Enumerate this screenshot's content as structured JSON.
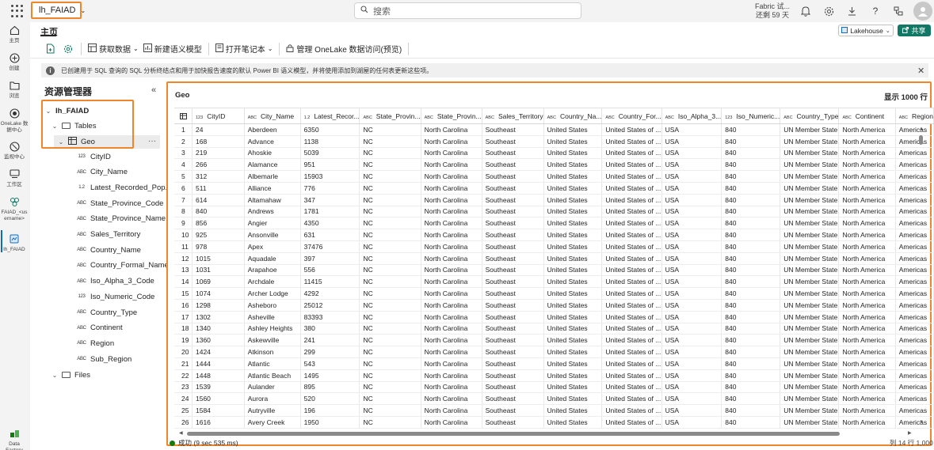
{
  "app": {
    "workspace_name": "lh_FAIAD",
    "search_placeholder": "搜索",
    "trial_line1": "Fabric 试...",
    "trial_line2": "还剩 59 天"
  },
  "rail": [
    {
      "label": "主页",
      "icon": "home-icon"
    },
    {
      "label": "创建",
      "icon": "create-icon"
    },
    {
      "label": "浏览",
      "icon": "browse-icon"
    },
    {
      "label": "OneLake 数据中心",
      "icon": "onelake-icon"
    },
    {
      "label": "监视中心",
      "icon": "monitor-icon"
    },
    {
      "label": "工作区",
      "icon": "workspaces-icon"
    },
    {
      "label": "FAIAD_<username>",
      "icon": "workspace-icon"
    },
    {
      "label": "lh_FAIAD",
      "icon": "lakehouse-icon"
    },
    {
      "label": "Data Factory",
      "icon": "data-factory-icon"
    }
  ],
  "ribbon": {
    "tab_home": "主页",
    "get_data": "获取数据",
    "new_semantic_model": "新建语义模型",
    "open_notebook": "打开笔记本",
    "manage_onelake": "管理 OneLake 数据访问(预览)",
    "lakehouse_switch": "Lakehouse",
    "share": "共享"
  },
  "info_message": "已创建用于 SQL 查询的 SQL 分析终结点和用于加快报告速度的默认 Power BI 语义模型，并将使用添加到湖屋的任何表更新这些项。",
  "explorer": {
    "title": "资源管理器",
    "lakehouse": "lh_FAIAD",
    "tables_label": "Tables",
    "table_name": "Geo",
    "files_label": "Files",
    "columns": [
      {
        "type": "123",
        "name": "CityID"
      },
      {
        "type": "ABC",
        "name": "City_Name"
      },
      {
        "type": "1.2",
        "name": "Latest_Recorded_Pop..."
      },
      {
        "type": "ABC",
        "name": "State_Province_Code"
      },
      {
        "type": "ABC",
        "name": "State_Province_Name"
      },
      {
        "type": "ABC",
        "name": "Sales_Territory"
      },
      {
        "type": "ABC",
        "name": "Country_Name"
      },
      {
        "type": "ABC",
        "name": "Country_Formal_Name"
      },
      {
        "type": "ABC",
        "name": "Iso_Alpha_3_Code"
      },
      {
        "type": "123",
        "name": "Iso_Numeric_Code"
      },
      {
        "type": "ABC",
        "name": "Country_Type"
      },
      {
        "type": "ABC",
        "name": "Continent"
      },
      {
        "type": "ABC",
        "name": "Region"
      },
      {
        "type": "ABC",
        "name": "Sub_Region"
      }
    ]
  },
  "grid": {
    "title": "Geo",
    "row_count_label": "显示 1000 行",
    "columns": [
      {
        "type": "123",
        "name": "CityID"
      },
      {
        "type": "ABC",
        "name": "City_Name"
      },
      {
        "type": "1.2",
        "name": "Latest_Recor..."
      },
      {
        "type": "ABC",
        "name": "State_Provin..."
      },
      {
        "type": "ABC",
        "name": "State_Provin..."
      },
      {
        "type": "ABC",
        "name": "Sales_Territory"
      },
      {
        "type": "ABC",
        "name": "Country_Na..."
      },
      {
        "type": "ABC",
        "name": "Country_For..."
      },
      {
        "type": "ABC",
        "name": "Iso_Alpha_3..."
      },
      {
        "type": "123",
        "name": "Iso_Numeric..."
      },
      {
        "type": "ABC",
        "name": "Country_Type"
      },
      {
        "type": "ABC",
        "name": "Continent"
      },
      {
        "type": "ABC",
        "name": "Region"
      }
    ],
    "rows": [
      [
        "1",
        "24",
        "Aberdeen",
        "6350",
        "NC",
        "North Carolina",
        "Southeast",
        "United States",
        "United States of ...",
        "USA",
        "840",
        "UN Member State",
        "North America",
        "Americas"
      ],
      [
        "2",
        "168",
        "Advance",
        "1138",
        "NC",
        "North Carolina",
        "Southeast",
        "United States",
        "United States of ...",
        "USA",
        "840",
        "UN Member State",
        "North America",
        "Americas"
      ],
      [
        "3",
        "219",
        "Ahoskie",
        "5039",
        "NC",
        "North Carolina",
        "Southeast",
        "United States",
        "United States of ...",
        "USA",
        "840",
        "UN Member State",
        "North America",
        "Americas"
      ],
      [
        "4",
        "266",
        "Alamance",
        "951",
        "NC",
        "North Carolina",
        "Southeast",
        "United States",
        "United States of ...",
        "USA",
        "840",
        "UN Member State",
        "North America",
        "Americas"
      ],
      [
        "5",
        "312",
        "Albemarle",
        "15903",
        "NC",
        "North Carolina",
        "Southeast",
        "United States",
        "United States of ...",
        "USA",
        "840",
        "UN Member State",
        "North America",
        "Americas"
      ],
      [
        "6",
        "511",
        "Alliance",
        "776",
        "NC",
        "North Carolina",
        "Southeast",
        "United States",
        "United States of ...",
        "USA",
        "840",
        "UN Member State",
        "North America",
        "Americas"
      ],
      [
        "7",
        "614",
        "Altamahaw",
        "347",
        "NC",
        "North Carolina",
        "Southeast",
        "United States",
        "United States of ...",
        "USA",
        "840",
        "UN Member State",
        "North America",
        "Americas"
      ],
      [
        "8",
        "840",
        "Andrews",
        "1781",
        "NC",
        "North Carolina",
        "Southeast",
        "United States",
        "United States of ...",
        "USA",
        "840",
        "UN Member State",
        "North America",
        "Americas"
      ],
      [
        "9",
        "856",
        "Angier",
        "4350",
        "NC",
        "North Carolina",
        "Southeast",
        "United States",
        "United States of ...",
        "USA",
        "840",
        "UN Member State",
        "North America",
        "Americas"
      ],
      [
        "10",
        "925",
        "Ansonville",
        "631",
        "NC",
        "North Carolina",
        "Southeast",
        "United States",
        "United States of ...",
        "USA",
        "840",
        "UN Member State",
        "North America",
        "Americas"
      ],
      [
        "11",
        "978",
        "Apex",
        "37476",
        "NC",
        "North Carolina",
        "Southeast",
        "United States",
        "United States of ...",
        "USA",
        "840",
        "UN Member State",
        "North America",
        "Americas"
      ],
      [
        "12",
        "1015",
        "Aquadale",
        "397",
        "NC",
        "North Carolina",
        "Southeast",
        "United States",
        "United States of ...",
        "USA",
        "840",
        "UN Member State",
        "North America",
        "Americas"
      ],
      [
        "13",
        "1031",
        "Arapahoe",
        "556",
        "NC",
        "North Carolina",
        "Southeast",
        "United States",
        "United States of ...",
        "USA",
        "840",
        "UN Member State",
        "North America",
        "Americas"
      ],
      [
        "14",
        "1069",
        "Archdale",
        "11415",
        "NC",
        "North Carolina",
        "Southeast",
        "United States",
        "United States of ...",
        "USA",
        "840",
        "UN Member State",
        "North America",
        "Americas"
      ],
      [
        "15",
        "1074",
        "Archer Lodge",
        "4292",
        "NC",
        "North Carolina",
        "Southeast",
        "United States",
        "United States of ...",
        "USA",
        "840",
        "UN Member State",
        "North America",
        "Americas"
      ],
      [
        "16",
        "1298",
        "Asheboro",
        "25012",
        "NC",
        "North Carolina",
        "Southeast",
        "United States",
        "United States of ...",
        "USA",
        "840",
        "UN Member State",
        "North America",
        "Americas"
      ],
      [
        "17",
        "1302",
        "Asheville",
        "83393",
        "NC",
        "North Carolina",
        "Southeast",
        "United States",
        "United States of ...",
        "USA",
        "840",
        "UN Member State",
        "North America",
        "Americas"
      ],
      [
        "18",
        "1340",
        "Ashley Heights",
        "380",
        "NC",
        "North Carolina",
        "Southeast",
        "United States",
        "United States of ...",
        "USA",
        "840",
        "UN Member State",
        "North America",
        "Americas"
      ],
      [
        "19",
        "1360",
        "Askewville",
        "241",
        "NC",
        "North Carolina",
        "Southeast",
        "United States",
        "United States of ...",
        "USA",
        "840",
        "UN Member State",
        "North America",
        "Americas"
      ],
      [
        "20",
        "1424",
        "Atkinson",
        "299",
        "NC",
        "North Carolina",
        "Southeast",
        "United States",
        "United States of ...",
        "USA",
        "840",
        "UN Member State",
        "North America",
        "Americas"
      ],
      [
        "21",
        "1444",
        "Atlantic",
        "543",
        "NC",
        "North Carolina",
        "Southeast",
        "United States",
        "United States of ...",
        "USA",
        "840",
        "UN Member State",
        "North America",
        "Americas"
      ],
      [
        "22",
        "1448",
        "Atlantic Beach",
        "1495",
        "NC",
        "North Carolina",
        "Southeast",
        "United States",
        "United States of ...",
        "USA",
        "840",
        "UN Member State",
        "North America",
        "Americas"
      ],
      [
        "23",
        "1539",
        "Aulander",
        "895",
        "NC",
        "North Carolina",
        "Southeast",
        "United States",
        "United States of ...",
        "USA",
        "840",
        "UN Member State",
        "North America",
        "Americas"
      ],
      [
        "24",
        "1560",
        "Aurora",
        "520",
        "NC",
        "North Carolina",
        "Southeast",
        "United States",
        "United States of ...",
        "USA",
        "840",
        "UN Member State",
        "North America",
        "Americas"
      ],
      [
        "25",
        "1584",
        "Autryville",
        "196",
        "NC",
        "North Carolina",
        "Southeast",
        "United States",
        "United States of ...",
        "USA",
        "840",
        "UN Member State",
        "North America",
        "Americas"
      ],
      [
        "26",
        "1616",
        "Avery Creek",
        "1950",
        "NC",
        "North Carolina",
        "Southeast",
        "United States",
        "United States of ...",
        "USA",
        "840",
        "UN Member State",
        "North America",
        "Americas"
      ]
    ],
    "status": "成功 (9 sec 535 ms)",
    "position": "列 14 行 1,000"
  },
  "colors": {
    "highlight": "#f0862a",
    "share": "#117865",
    "success": "#107c10"
  }
}
